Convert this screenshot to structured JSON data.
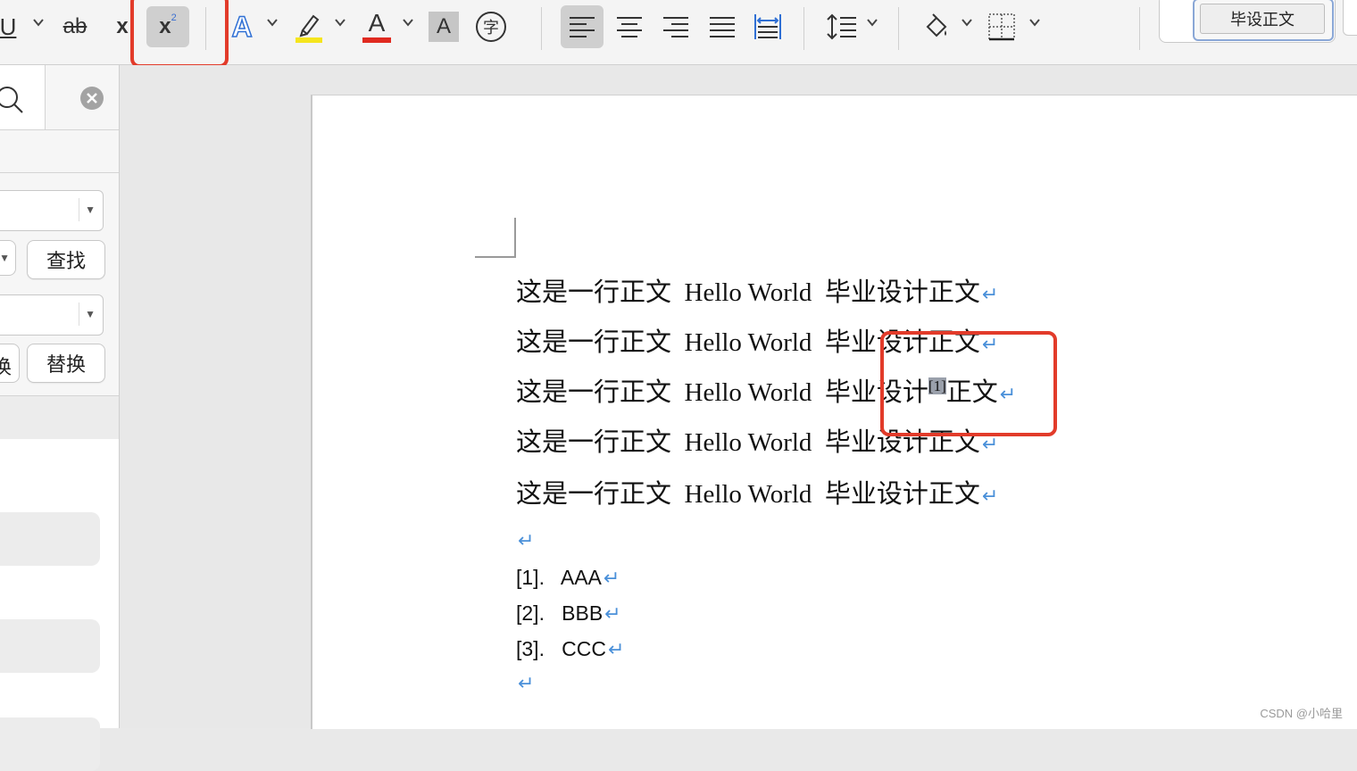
{
  "toolbar": {
    "underline": "U",
    "strike": "ab",
    "subscript": "x",
    "superscript": "x",
    "superscript_mark": "2",
    "effects": "A",
    "font_color": "A",
    "char_shade": "A",
    "enclose": "字",
    "style_name": "毕设正文"
  },
  "sidebar": {
    "find_label": "查找",
    "replace_label": "替换",
    "clipped_label": "换"
  },
  "document": {
    "lines": [
      {
        "pre": "这是一行正文  Hello World  毕业设计正文",
        "sup": "",
        "post": ""
      },
      {
        "pre": "这是一行正文  Hello World  毕业设计正文",
        "sup": "",
        "post": ""
      },
      {
        "pre": "这是一行正文  Hello World  毕业设计",
        "sup": "[1]",
        "post": "正文"
      },
      {
        "pre": "这是一行正文  Hello World  毕业设计正文",
        "sup": "",
        "post": ""
      },
      {
        "pre": "这是一行正文  Hello World  毕业设计正文",
        "sup": "",
        "post": ""
      }
    ],
    "return_mark": "↵",
    "references": [
      {
        "num": "[1].",
        "text": "AAA"
      },
      {
        "num": "[2].",
        "text": "BBB"
      },
      {
        "num": "[3].",
        "text": "CCC"
      }
    ]
  },
  "watermark": "CSDN @小哈里",
  "colors": {
    "highlight_frame": "#e23b2a",
    "return_mark": "#4a90d9",
    "selection": "#9aa0ab",
    "highlight_yellow": "#f5e51d",
    "font_red": "#e02a20"
  }
}
